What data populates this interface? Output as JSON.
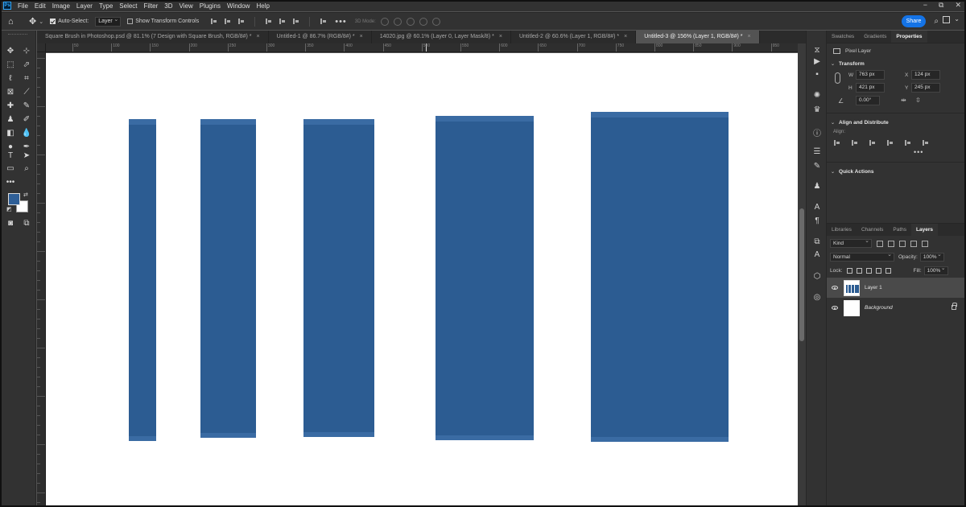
{
  "app": {
    "logo": "Ps"
  },
  "menu": [
    "File",
    "Edit",
    "Image",
    "Layer",
    "Type",
    "Select",
    "Filter",
    "3D",
    "View",
    "Plugins",
    "Window",
    "Help"
  ],
  "window_controls": [
    "−",
    "⧉",
    "✕"
  ],
  "options_bar": {
    "auto_select_label": "Auto-Select:",
    "auto_select_checked": true,
    "auto_select_target": "Layer",
    "show_transform_label": "Show Transform Controls",
    "show_transform_checked": false,
    "mode_3d_label": "3D Mode:",
    "share_label": "Share"
  },
  "tabs": [
    {
      "title": "Square Brush in Photoshop.psd @ 81.1% (7 Design with Square Brush, RGB/8#) *",
      "active": false
    },
    {
      "title": "Untitled-1 @ 86.7% (RGB/8#) *",
      "active": false
    },
    {
      "title": "14020.jpg @ 60.1% (Layer 0, Layer Mask/8) *",
      "active": false
    },
    {
      "title": "Untitled-2 @ 60.6% (Layer 1, RGB/8#) *",
      "active": false
    },
    {
      "title": "Untitled-3 @ 156% (Layer 1, RGB/8#) *",
      "active": true
    }
  ],
  "ruler": {
    "top_labels": [
      "50",
      "100",
      "150",
      "200",
      "250",
      "300",
      "350",
      "400",
      "450",
      "500",
      "550",
      "600",
      "650",
      "700",
      "750",
      "800",
      "850",
      "900",
      "950"
    ]
  },
  "colors": {
    "foreground": "#2f5f97",
    "background": "#ffffff",
    "accent": "#1473e6",
    "stroke_blue": "#2c5c92"
  },
  "properties_panel": {
    "tabs": [
      "Swatches",
      "Gradients",
      "Properties"
    ],
    "active_tab": "Properties",
    "layer_type": "Pixel Layer",
    "transform": {
      "heading": "Transform",
      "w_label": "W",
      "w": "763 px",
      "h_label": "H",
      "h": "421 px",
      "x_label": "X",
      "x": "124 px",
      "y_label": "Y",
      "y": "245 px",
      "angle": "0.00°"
    },
    "align_heading": "Align and Distribute",
    "align_label": "Align:",
    "quick_actions_heading": "Quick Actions"
  },
  "layers_panel": {
    "tabs": [
      "Libraries",
      "Channels",
      "Paths",
      "Layers"
    ],
    "active_tab": "Layers",
    "filter_kind": "Kind",
    "blend_mode": "Normal",
    "opacity_label": "Opacity:",
    "opacity": "100%",
    "lock_label": "Lock:",
    "fill_label": "Fill:",
    "fill": "100%",
    "layers": [
      {
        "name": "Layer 1",
        "selected": true,
        "visible": true,
        "locked": false
      },
      {
        "name": "Background",
        "selected": false,
        "visible": true,
        "locked": true
      }
    ]
  }
}
